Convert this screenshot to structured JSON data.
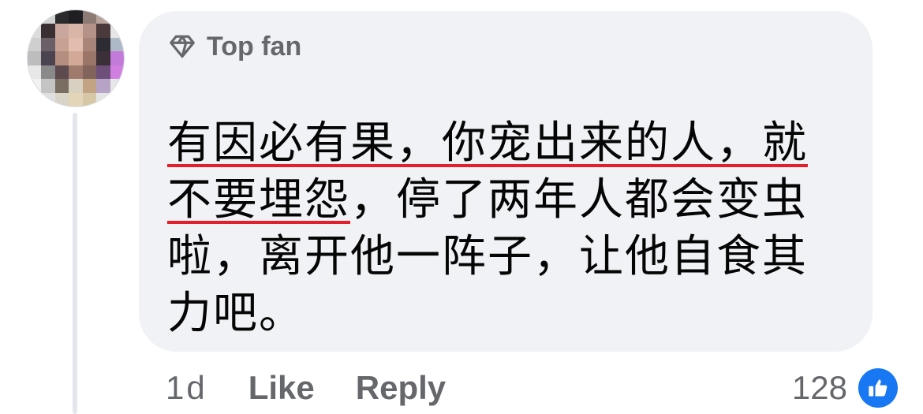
{
  "comment": {
    "badge": {
      "label": "Top fan",
      "icon": "diamond-icon"
    },
    "author_name_visible": false,
    "text_lines": [
      {
        "underlined": "有因必有果，你宠出来的人，就"
      },
      {
        "underlined": "不要埋怨",
        "rest": "，停了两年人都会变虫"
      },
      {
        "plain": "啦，离开他一阵子，让他自食其"
      },
      {
        "plain": "力吧。"
      }
    ],
    "timestamp": "1d",
    "like_label": "Like",
    "reply_label": "Reply",
    "reaction_count": "128",
    "reaction_icon": "thumbs-up-icon"
  },
  "colors": {
    "bubble": "#f0f2f5",
    "secondary_text": "#65676b",
    "primary_text": "#050505",
    "underline": "#e41e2b",
    "like_blue": "#1877f2"
  }
}
